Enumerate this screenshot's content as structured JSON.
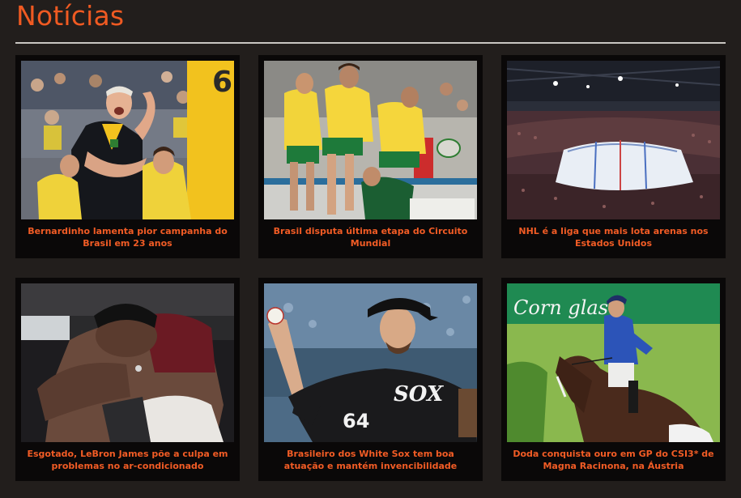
{
  "section": {
    "title": "Notícias"
  },
  "news": [
    {
      "caption": "Bernardinho lamenta pior campanha do Brasil em 23 anos",
      "photo": "volleyball-coach-photo"
    },
    {
      "caption": "Brasil disputa última etapa do Circuito Mundial",
      "photo": "rugby-sevens-photo"
    },
    {
      "caption": "NHL é a liga que mais lota arenas nos Estados Unidos",
      "photo": "hockey-arena-photo"
    },
    {
      "caption": "Esgotado, LeBron James põe a culpa em problemas no ar-condicionado",
      "photo": "basketball-player-photo"
    },
    {
      "caption": "Brasileiro dos White Sox tem boa atuação e mantém invencibilidade",
      "photo": "baseball-pitcher-photo"
    },
    {
      "caption": "Doda conquista ouro em GP do CSI3* de Magna Racinona, na Áustria",
      "photo": "show-jumping-photo"
    }
  ],
  "photo_text": {
    "jersey_number": "64",
    "team_logo": "SOX",
    "banner": "Corn glas"
  },
  "colors": {
    "accent": "#f05a22",
    "background": "#221e1c",
    "card": "#0a0808"
  }
}
